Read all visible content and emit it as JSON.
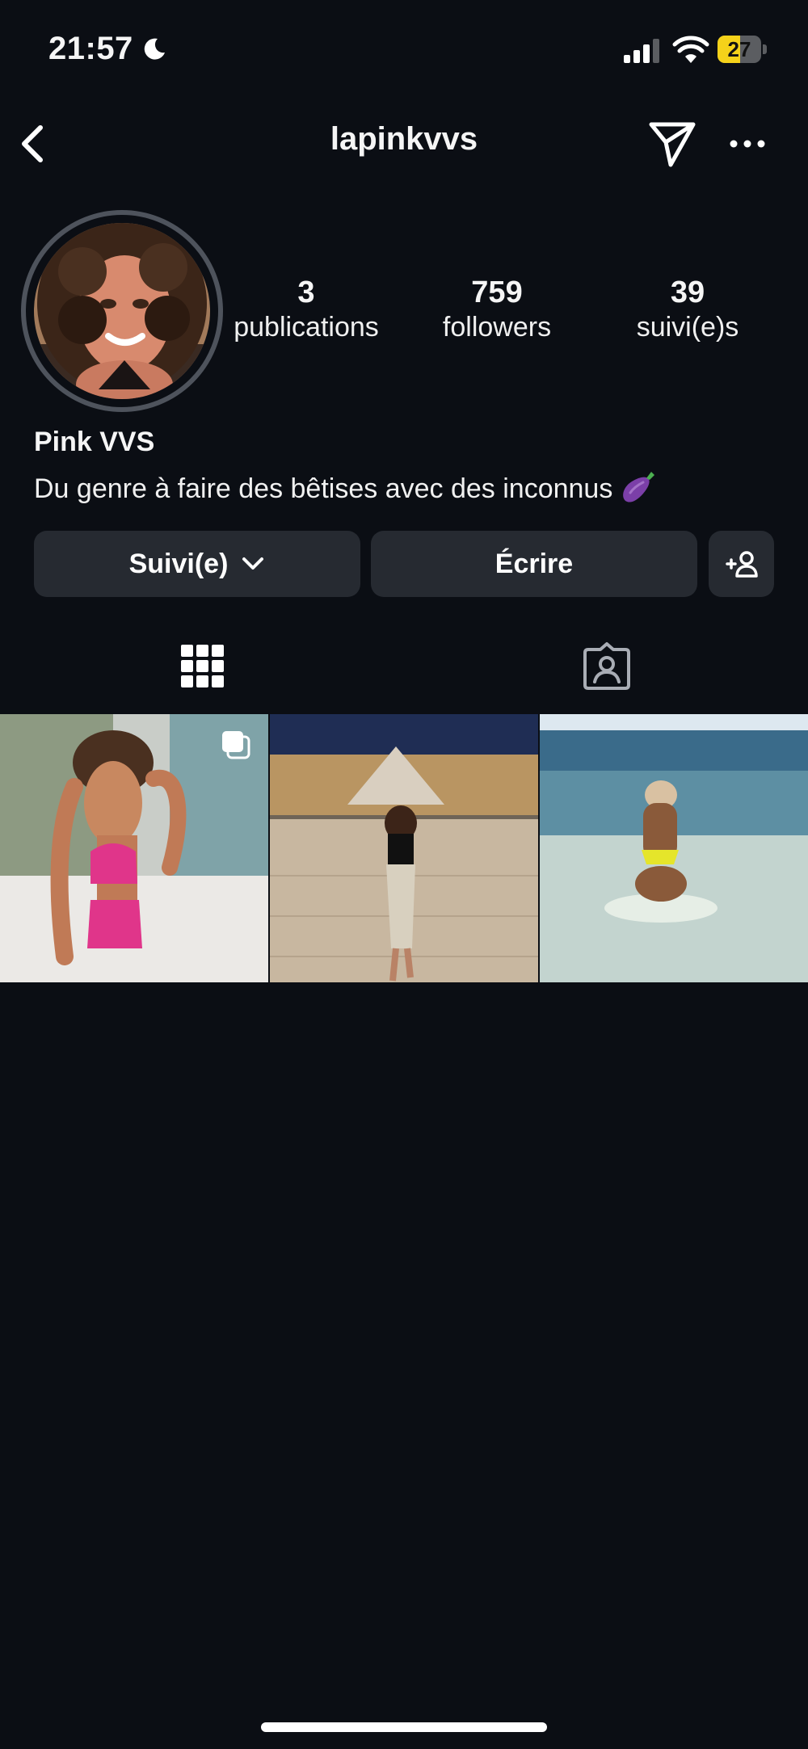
{
  "status_bar": {
    "time": "21:57",
    "battery": "27",
    "battery_level": 0.27,
    "focus_icon": "moon-icon"
  },
  "header": {
    "username": "lapinkvvs",
    "back_icon": "chevron-left-icon",
    "send_icon": "paper-plane-icon",
    "more_icon": "ellipsis-icon"
  },
  "profile": {
    "stats": [
      {
        "value": "3",
        "label": "publications"
      },
      {
        "value": "759",
        "label": "followers"
      },
      {
        "value": "39",
        "label": "suivi(e)s"
      }
    ],
    "display_name": "Pink VVS",
    "bio": "Du genre à faire des bêtises avec des inconnus"
  },
  "actions": {
    "follow_label": "Suivi(e)",
    "message_label": "Écrire",
    "add_icon": "add-person-icon"
  },
  "tabs": [
    {
      "icon": "grid-icon",
      "active": true
    },
    {
      "icon": "tagged-person-icon",
      "active": false
    }
  ],
  "posts": [
    {
      "scene": "pink-lingerie-bed",
      "multi": true
    },
    {
      "scene": "louvre-night",
      "multi": false
    },
    {
      "scene": "beach-water",
      "multi": false
    }
  ],
  "colors": {
    "background": "#0b0e14",
    "button": "#262a31",
    "battery": "#f5d21a"
  }
}
